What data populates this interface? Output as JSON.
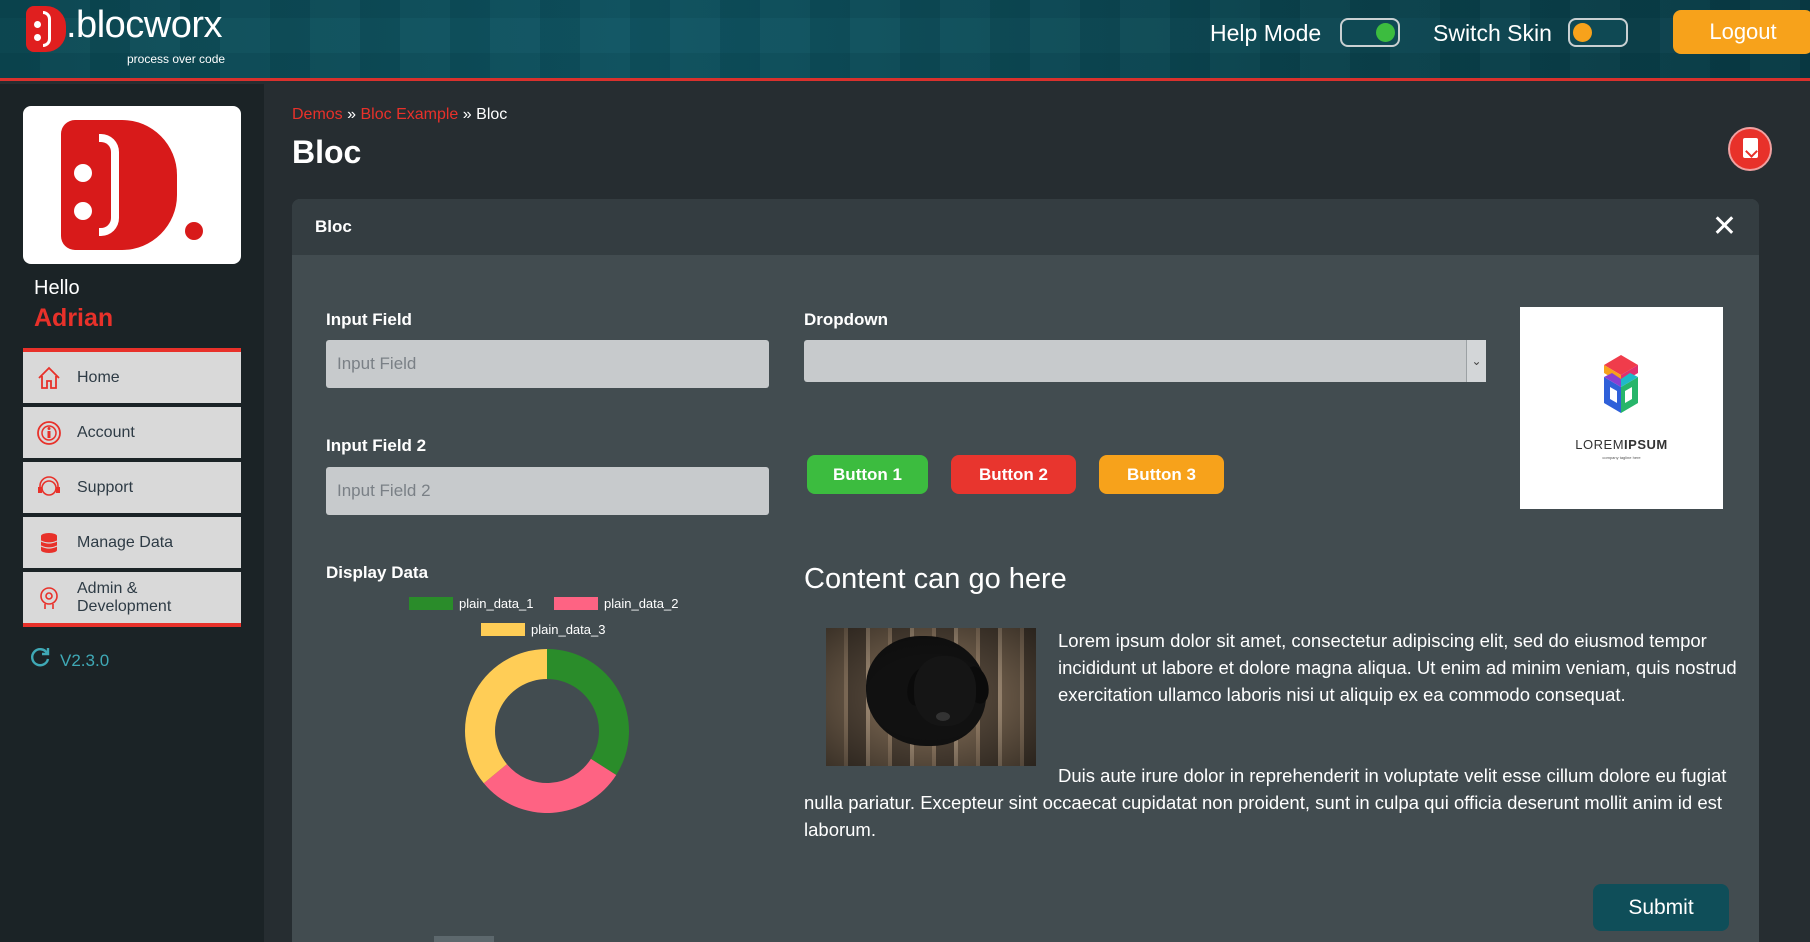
{
  "header": {
    "brand": ".blocworx",
    "tagline": "process over code",
    "help_mode_label": "Help Mode",
    "switch_skin_label": "Switch Skin",
    "logout_label": "Logout",
    "help_mode_on": true,
    "switch_skin_on": false
  },
  "sidebar": {
    "greeting": "Hello",
    "user_name": "Adrian",
    "items": [
      {
        "label": "Home",
        "icon": "home-icon"
      },
      {
        "label": "Account",
        "icon": "account-icon"
      },
      {
        "label": "Support",
        "icon": "support-icon"
      },
      {
        "label": "Manage Data",
        "icon": "database-icon"
      },
      {
        "label": "Admin & Development",
        "icon": "admin-icon"
      }
    ],
    "version": "V2.3.0"
  },
  "breadcrumb": {
    "items": [
      "Demos",
      "Bloc Example",
      "Bloc"
    ],
    "separator": "»"
  },
  "page_title": "Bloc",
  "panel": {
    "title": "Bloc",
    "input_field": {
      "label": "Input Field",
      "placeholder": "Input Field"
    },
    "input_field_2": {
      "label": "Input Field 2",
      "placeholder": "Input Field 2"
    },
    "dropdown": {
      "label": "Dropdown",
      "value": ""
    },
    "buttons": [
      {
        "label": "Button 1",
        "color": "#3cbc3f"
      },
      {
        "label": "Button 2",
        "color": "#e8352e"
      },
      {
        "label": "Button 3",
        "color": "#f7a21b"
      }
    ],
    "logo_card": {
      "word1": "LOREM",
      "word2": "IPSUM",
      "tagline": "company tagline here"
    },
    "display_data_label": "Display Data",
    "content_title": "Content can go here",
    "paragraph_1": "Lorem ipsum dolor sit amet, consectetur adipiscing elit, sed do eiusmod tempor incididunt ut labore et dolore magna aliqua. Ut enim ad minim veniam, quis nostrud exercitation ullamco laboris nisi ut aliquip ex ea commodo consequat.",
    "paragraph_2": "Duis aute irure dolor in reprehenderit in voluptate velit esse cillum dolore eu fugiat nulla pariatur. Excepteur sint occaecat cupidatat non proident, sunt in culpa qui officia deserunt mollit anim id est laborum.",
    "submit_label": "Submit"
  },
  "chart_data": {
    "type": "pie",
    "categories": [
      "plain_data_1",
      "plain_data_2",
      "plain_data_3"
    ],
    "values": [
      34,
      30,
      36
    ],
    "colors": [
      "#2a8c2a",
      "#fe6383",
      "#ffcd56"
    ],
    "legend_position": "top",
    "donut": true
  },
  "colors": {
    "accent": "#e8312a",
    "header_bg": "#0f5563",
    "logout": "#f7a21b",
    "submit": "#0f4e59",
    "toggle_on": "#3cbc3f",
    "toggle_off": "#f7a21b"
  }
}
